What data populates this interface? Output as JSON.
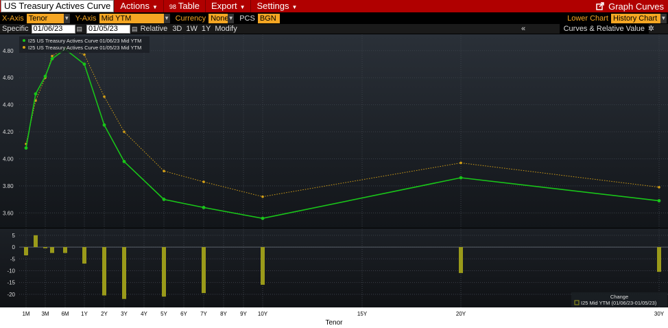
{
  "header": {
    "title": "US Treasury Actives Curve",
    "menus": [
      "Actions",
      "Table",
      "Export",
      "Settings"
    ],
    "table_icon": "98",
    "graph_curves": "Graph Curves"
  },
  "controls": {
    "xaxis_label": "X-Axis",
    "xaxis_value": "Tenor",
    "yaxis_label": "Y-Axis",
    "yaxis_value": "Mid YTM",
    "currency_label": "Currency",
    "currency_value": "None",
    "pcs_label": "PCS",
    "pcs_value": "BGN",
    "lower_chart_label": "Lower Chart",
    "lower_chart_value": "History Chart"
  },
  "datebar": {
    "specific_label": "Specific",
    "date1": "01/06/23",
    "date2": "01/05/23",
    "relative_label": "Relative",
    "ranges": [
      "3D",
      "1W",
      "1Y"
    ],
    "modify_label": "Modify",
    "collapse_label": "«",
    "panel_title": "Curves & Relative Value"
  },
  "chart_data": {
    "type": "line",
    "xlabel": "Tenor",
    "tenor_axis_labels": [
      "1M",
      "3M",
      "6M",
      "1Y",
      "2Y",
      "3Y",
      "4Y",
      "5Y",
      "6Y",
      "7Y",
      "8Y",
      "9Y",
      "10Y",
      "15Y",
      "20Y",
      "30Y"
    ],
    "upper": {
      "ylim": [
        3.5,
        4.88
      ],
      "ticks": [
        "3.60",
        "3.80",
        "4.00",
        "4.20",
        "4.40",
        "4.60",
        "4.80"
      ],
      "series": [
        {
          "name": "I25 US Treasury Actives Curve 01/06/23 Mid YTM",
          "color": "#19c519",
          "style": "solid",
          "tenors": [
            "1M",
            "2M",
            "3M",
            "4M",
            "6M",
            "1Y",
            "2Y",
            "3Y",
            "5Y",
            "7Y",
            "10Y",
            "20Y",
            "30Y"
          ],
          "values": [
            4.08,
            4.48,
            4.61,
            4.74,
            4.81,
            4.7,
            4.25,
            3.98,
            3.7,
            3.64,
            3.56,
            3.86,
            3.69
          ]
        },
        {
          "name": "I25 US Treasury Actives Curve 01/05/23 Mid YTM",
          "color": "#d4a017",
          "style": "dotted",
          "tenors": [
            "1M",
            "2M",
            "3M",
            "4M",
            "6M",
            "1Y",
            "2Y",
            "3Y",
            "5Y",
            "7Y",
            "10Y",
            "20Y",
            "30Y"
          ],
          "values": [
            4.11,
            4.43,
            4.6,
            4.76,
            4.82,
            4.77,
            4.46,
            4.2,
            3.91,
            3.83,
            3.72,
            3.97,
            3.79
          ]
        }
      ]
    },
    "lower": {
      "ylim": [
        -25,
        7
      ],
      "ticks": [
        "5",
        "0",
        "-5",
        "-10",
        "-15",
        "-20"
      ],
      "legend_title": "Change",
      "series_name": "I25 Mid YTM (01/06/23-01/05/23)",
      "color": "#9a9a1a",
      "tenors": [
        "1M",
        "2M",
        "3M",
        "4M",
        "6M",
        "1Y",
        "2Y",
        "3Y",
        "5Y",
        "7Y",
        "10Y",
        "20Y",
        "30Y"
      ],
      "values": [
        -3.5,
        5,
        -0.5,
        -2.5,
        -2.5,
        -7,
        -20.5,
        -22,
        -21,
        -19.5,
        -16,
        -11,
        -10.5
      ]
    }
  }
}
